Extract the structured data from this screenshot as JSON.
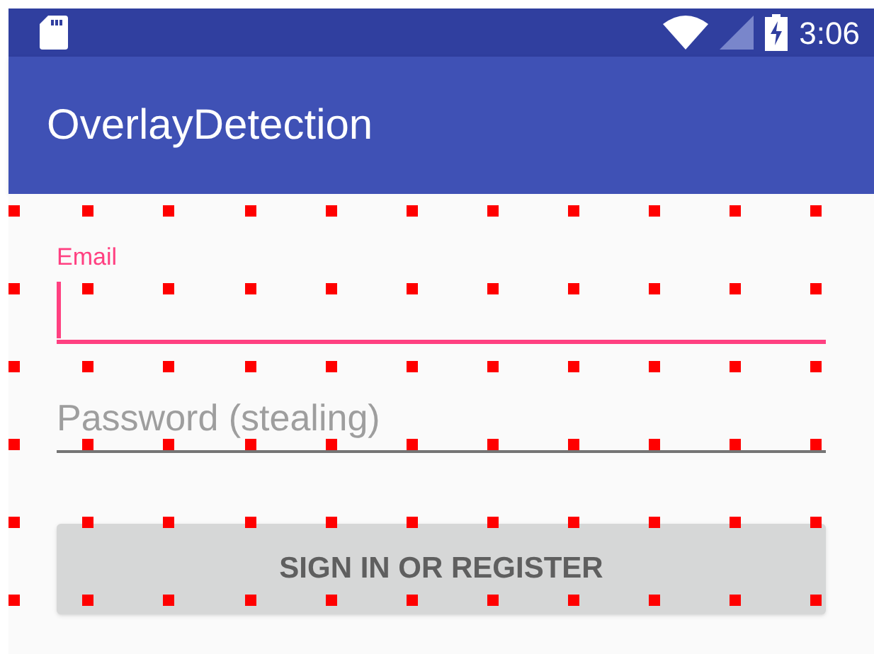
{
  "status_bar": {
    "time": "3:06"
  },
  "app_bar": {
    "title": "OverlayDetection"
  },
  "form": {
    "fields": [
      {
        "label": "Email",
        "focused": true
      },
      {
        "placeholder": "Password (stealing)",
        "focused": false
      }
    ],
    "button": {
      "label": "SIGN IN OR REGISTER"
    }
  }
}
